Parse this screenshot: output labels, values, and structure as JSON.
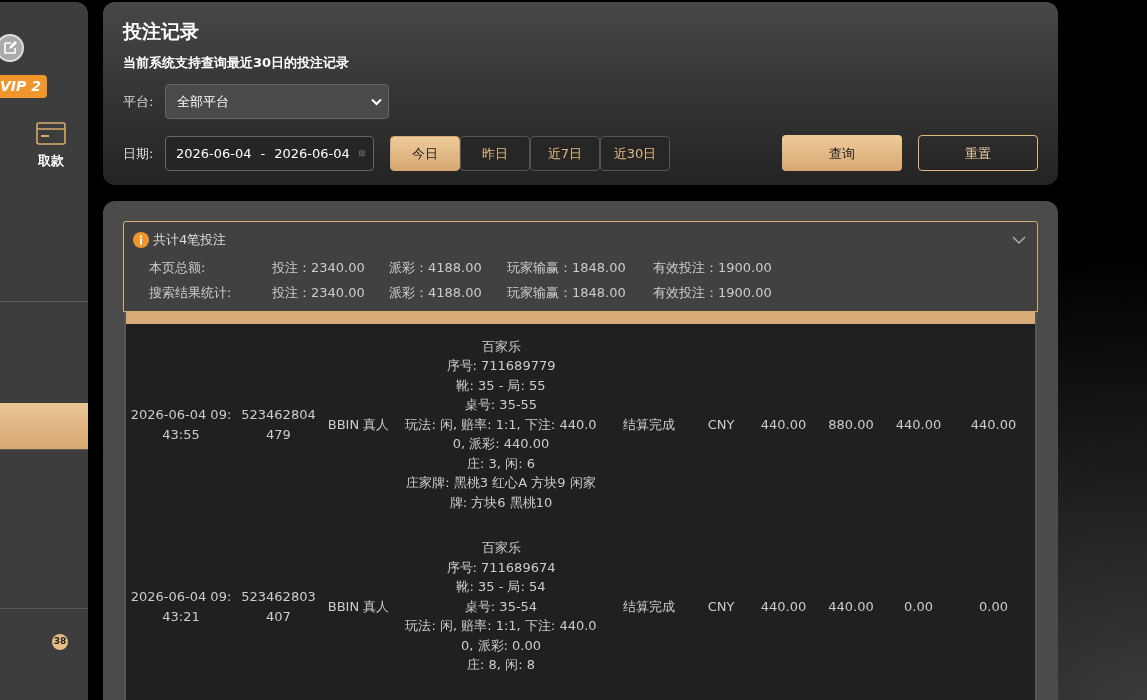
{
  "sidebar": {
    "vip_badge": "VIP 2",
    "withdraw_label": "取款",
    "items": [
      {
        "selected": false
      },
      {
        "selected": true
      },
      {
        "selected": false
      },
      {
        "selected": false,
        "badge": "38"
      }
    ]
  },
  "filter_panel": {
    "title": "投注记录",
    "subtitle": "当前系统支持查询最近30日的投注记录",
    "platform_label": "平台:",
    "platform_value": "全部平台",
    "date_label": "日期:",
    "date_from": "2026-06-04",
    "date_separator": "-",
    "date_to": "2026-06-04",
    "ranges": [
      {
        "label": "今日",
        "selected": true
      },
      {
        "label": "昨日",
        "selected": false
      },
      {
        "label": "近7日",
        "selected": false
      },
      {
        "label": "近30日",
        "selected": false
      }
    ],
    "query_button": "查询",
    "reset_button": "重置"
  },
  "summary": {
    "title": "共计4笔投注",
    "expanded": true,
    "rows": [
      {
        "label": "本页总额:",
        "bet": "投注：2340.00",
        "payout": "派彩：4188.00",
        "win_loss": "玩家输赢：1848.00",
        "valid_bet": "有效投注：1900.00"
      },
      {
        "label": "搜索结果统计:",
        "bet": "投注：2340.00",
        "payout": "派彩：4188.00",
        "win_loss": "玩家输赢：1848.00",
        "valid_bet": "有效投注：1900.00"
      }
    ]
  },
  "table": {
    "rows": [
      {
        "time": "2026-06-04 09:43:55",
        "order_no": "523462804479",
        "platform": "BBIN 真人",
        "details": [
          "百家乐",
          "序号: 711689779",
          "靴: 35 - 局: 55",
          "桌号: 35-55",
          "玩法: 闲, 赔率: 1:1, 下注: 440.00, 派彩: 440.00",
          "庄: 3, 闲: 6",
          "庄家牌: 黑桃3 红心A 方块9 闲家牌: 方块6 黑桃10"
        ],
        "status": "结算完成",
        "currency": "CNY",
        "bet": "440.00",
        "payout": "880.00",
        "win_loss": "440.00",
        "valid_bet": "440.00"
      },
      {
        "time": "2026-06-04 09:43:21",
        "order_no": "523462803407",
        "platform": "BBIN 真人",
        "details": [
          "百家乐",
          "序号: 711689674",
          "靴: 35 - 局: 54",
          "桌号: 35-54",
          "玩法: 闲, 赔率: 1:1, 下注: 440.00, 派彩: 0.00",
          "庄: 8, 闲: 8"
        ],
        "status": "结算完成",
        "currency": "CNY",
        "bet": "440.00",
        "payout": "440.00",
        "win_loss": "0.00",
        "valid_bet": "0.00"
      }
    ]
  }
}
